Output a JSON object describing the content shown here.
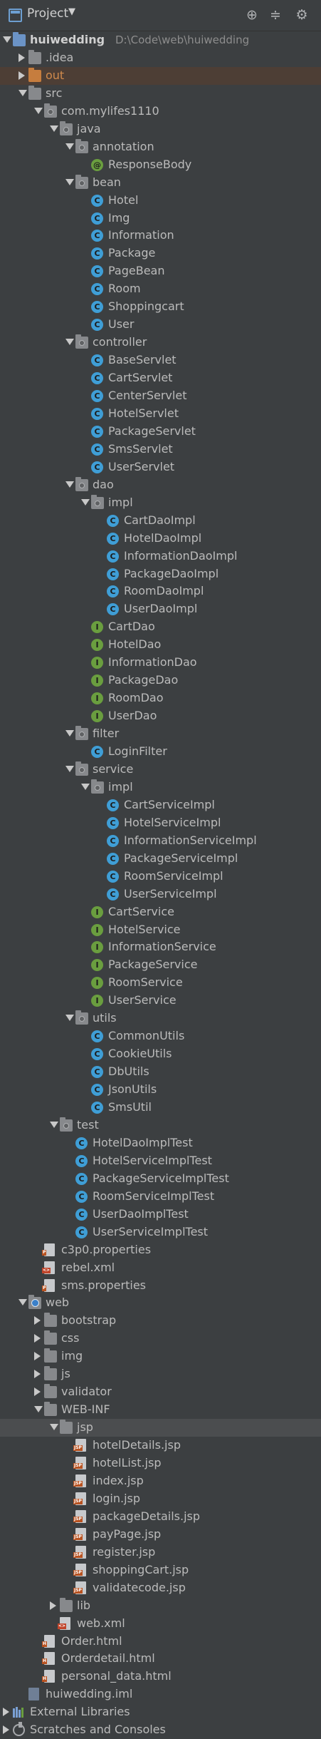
{
  "header": {
    "title": "Project",
    "icons": [
      "crosshair-icon",
      "collapse-icon",
      "gear-icon"
    ]
  },
  "root": {
    "name": "huiwedding",
    "path": "D:\\Code\\web\\huiwedding"
  },
  "tree": [
    {
      "label": "huiwedding",
      "path": "D:\\Code\\web\\huiwedding",
      "depth": 0,
      "arrow": "open",
      "icon": "module-folder",
      "bold": true
    },
    {
      "label": ".idea",
      "depth": 1,
      "arrow": "closed",
      "icon": "folder"
    },
    {
      "label": "out",
      "depth": 1,
      "arrow": "closed",
      "icon": "folder-orange",
      "excluded": true
    },
    {
      "label": "src",
      "depth": 1,
      "arrow": "open",
      "icon": "folder"
    },
    {
      "label": "com.mylifes1110",
      "depth": 2,
      "arrow": "open",
      "icon": "package"
    },
    {
      "label": "java",
      "depth": 3,
      "arrow": "open",
      "icon": "package"
    },
    {
      "label": "annotation",
      "depth": 4,
      "arrow": "open",
      "icon": "package"
    },
    {
      "label": "ResponseBody",
      "depth": 5,
      "arrow": "none",
      "icon": "annotation"
    },
    {
      "label": "bean",
      "depth": 4,
      "arrow": "open",
      "icon": "package"
    },
    {
      "label": "Hotel",
      "depth": 5,
      "arrow": "none",
      "icon": "class"
    },
    {
      "label": "Img",
      "depth": 5,
      "arrow": "none",
      "icon": "class"
    },
    {
      "label": "Information",
      "depth": 5,
      "arrow": "none",
      "icon": "class"
    },
    {
      "label": "Package",
      "depth": 5,
      "arrow": "none",
      "icon": "class"
    },
    {
      "label": "PageBean",
      "depth": 5,
      "arrow": "none",
      "icon": "class"
    },
    {
      "label": "Room",
      "depth": 5,
      "arrow": "none",
      "icon": "class"
    },
    {
      "label": "Shoppingcart",
      "depth": 5,
      "arrow": "none",
      "icon": "class"
    },
    {
      "label": "User",
      "depth": 5,
      "arrow": "none",
      "icon": "class"
    },
    {
      "label": "controller",
      "depth": 4,
      "arrow": "open",
      "icon": "package"
    },
    {
      "label": "BaseServlet",
      "depth": 5,
      "arrow": "none",
      "icon": "class"
    },
    {
      "label": "CartServlet",
      "depth": 5,
      "arrow": "none",
      "icon": "class"
    },
    {
      "label": "CenterServlet",
      "depth": 5,
      "arrow": "none",
      "icon": "class"
    },
    {
      "label": "HotelServlet",
      "depth": 5,
      "arrow": "none",
      "icon": "class"
    },
    {
      "label": "PackageServlet",
      "depth": 5,
      "arrow": "none",
      "icon": "class"
    },
    {
      "label": "SmsServlet",
      "depth": 5,
      "arrow": "none",
      "icon": "class"
    },
    {
      "label": "UserServlet",
      "depth": 5,
      "arrow": "none",
      "icon": "class"
    },
    {
      "label": "dao",
      "depth": 4,
      "arrow": "open",
      "icon": "package"
    },
    {
      "label": "impl",
      "depth": 5,
      "arrow": "open",
      "icon": "package"
    },
    {
      "label": "CartDaoImpl",
      "depth": 6,
      "arrow": "none",
      "icon": "class"
    },
    {
      "label": "HotelDaoImpl",
      "depth": 6,
      "arrow": "none",
      "icon": "class"
    },
    {
      "label": "InformationDaoImpl",
      "depth": 6,
      "arrow": "none",
      "icon": "class"
    },
    {
      "label": "PackageDaoImpl",
      "depth": 6,
      "arrow": "none",
      "icon": "class"
    },
    {
      "label": "RoomDaoImpl",
      "depth": 6,
      "arrow": "none",
      "icon": "class"
    },
    {
      "label": "UserDaoImpl",
      "depth": 6,
      "arrow": "none",
      "icon": "class"
    },
    {
      "label": "CartDao",
      "depth": 5,
      "arrow": "none",
      "icon": "interface"
    },
    {
      "label": "HotelDao",
      "depth": 5,
      "arrow": "none",
      "icon": "interface"
    },
    {
      "label": "InformationDao",
      "depth": 5,
      "arrow": "none",
      "icon": "interface"
    },
    {
      "label": "PackageDao",
      "depth": 5,
      "arrow": "none",
      "icon": "interface"
    },
    {
      "label": "RoomDao",
      "depth": 5,
      "arrow": "none",
      "icon": "interface"
    },
    {
      "label": "UserDao",
      "depth": 5,
      "arrow": "none",
      "icon": "interface"
    },
    {
      "label": "filter",
      "depth": 4,
      "arrow": "open",
      "icon": "package"
    },
    {
      "label": "LoginFilter",
      "depth": 5,
      "arrow": "none",
      "icon": "class"
    },
    {
      "label": "service",
      "depth": 4,
      "arrow": "open",
      "icon": "package"
    },
    {
      "label": "impl",
      "depth": 5,
      "arrow": "open",
      "icon": "package"
    },
    {
      "label": "CartServiceImpl",
      "depth": 6,
      "arrow": "none",
      "icon": "class"
    },
    {
      "label": "HotelServiceImpl",
      "depth": 6,
      "arrow": "none",
      "icon": "class"
    },
    {
      "label": "InformationServiceImpl",
      "depth": 6,
      "arrow": "none",
      "icon": "class"
    },
    {
      "label": "PackageServiceImpl",
      "depth": 6,
      "arrow": "none",
      "icon": "class"
    },
    {
      "label": "RoomServiceImpl",
      "depth": 6,
      "arrow": "none",
      "icon": "class"
    },
    {
      "label": "UserServiceImpl",
      "depth": 6,
      "arrow": "none",
      "icon": "class"
    },
    {
      "label": "CartService",
      "depth": 5,
      "arrow": "none",
      "icon": "interface"
    },
    {
      "label": "HotelService",
      "depth": 5,
      "arrow": "none",
      "icon": "interface"
    },
    {
      "label": "InformationService",
      "depth": 5,
      "arrow": "none",
      "icon": "interface"
    },
    {
      "label": "PackageService",
      "depth": 5,
      "arrow": "none",
      "icon": "interface"
    },
    {
      "label": "RoomService",
      "depth": 5,
      "arrow": "none",
      "icon": "interface"
    },
    {
      "label": "UserService",
      "depth": 5,
      "arrow": "none",
      "icon": "interface"
    },
    {
      "label": "utils",
      "depth": 4,
      "arrow": "open",
      "icon": "package"
    },
    {
      "label": "CommonUtils",
      "depth": 5,
      "arrow": "none",
      "icon": "class"
    },
    {
      "label": "CookieUtils",
      "depth": 5,
      "arrow": "none",
      "icon": "class"
    },
    {
      "label": "DbUtils",
      "depth": 5,
      "arrow": "none",
      "icon": "class"
    },
    {
      "label": "JsonUtils",
      "depth": 5,
      "arrow": "none",
      "icon": "class"
    },
    {
      "label": "SmsUtil",
      "depth": 5,
      "arrow": "none",
      "icon": "class"
    },
    {
      "label": "test",
      "depth": 3,
      "arrow": "open",
      "icon": "package"
    },
    {
      "label": "HotelDaoImplTest",
      "depth": 4,
      "arrow": "none",
      "icon": "class"
    },
    {
      "label": "HotelServiceImplTest",
      "depth": 4,
      "arrow": "none",
      "icon": "class"
    },
    {
      "label": "PackageServiceImplTest",
      "depth": 4,
      "arrow": "none",
      "icon": "class"
    },
    {
      "label": "RoomServiceImplTest",
      "depth": 4,
      "arrow": "none",
      "icon": "class"
    },
    {
      "label": "UserDaoImplTest",
      "depth": 4,
      "arrow": "none",
      "icon": "class"
    },
    {
      "label": "UserServiceImplTest",
      "depth": 4,
      "arrow": "none",
      "icon": "class"
    },
    {
      "label": "c3p0.properties",
      "depth": 2,
      "arrow": "none",
      "icon": "properties-file"
    },
    {
      "label": "rebel.xml",
      "depth": 2,
      "arrow": "none",
      "icon": "xml-file"
    },
    {
      "label": "sms.properties",
      "depth": 2,
      "arrow": "none",
      "icon": "properties-file"
    },
    {
      "label": "web",
      "depth": 1,
      "arrow": "open",
      "icon": "web-folder"
    },
    {
      "label": "bootstrap",
      "depth": 2,
      "arrow": "closed",
      "icon": "folder"
    },
    {
      "label": "css",
      "depth": 2,
      "arrow": "closed",
      "icon": "folder"
    },
    {
      "label": "img",
      "depth": 2,
      "arrow": "closed",
      "icon": "folder"
    },
    {
      "label": "js",
      "depth": 2,
      "arrow": "closed",
      "icon": "folder"
    },
    {
      "label": "validator",
      "depth": 2,
      "arrow": "closed",
      "icon": "folder"
    },
    {
      "label": "WEB-INF",
      "depth": 2,
      "arrow": "open",
      "icon": "folder"
    },
    {
      "label": "jsp",
      "depth": 3,
      "arrow": "open",
      "icon": "folder",
      "selected": true
    },
    {
      "label": "hotelDetails.jsp",
      "depth": 4,
      "arrow": "none",
      "icon": "jsp-file"
    },
    {
      "label": "hotelList.jsp",
      "depth": 4,
      "arrow": "none",
      "icon": "jsp-file"
    },
    {
      "label": "index.jsp",
      "depth": 4,
      "arrow": "none",
      "icon": "jsp-file"
    },
    {
      "label": "login.jsp",
      "depth": 4,
      "arrow": "none",
      "icon": "jsp-file"
    },
    {
      "label": "packageDetails.jsp",
      "depth": 4,
      "arrow": "none",
      "icon": "jsp-file"
    },
    {
      "label": "payPage.jsp",
      "depth": 4,
      "arrow": "none",
      "icon": "jsp-file"
    },
    {
      "label": "register.jsp",
      "depth": 4,
      "arrow": "none",
      "icon": "jsp-file"
    },
    {
      "label": "shoppingCart.jsp",
      "depth": 4,
      "arrow": "none",
      "icon": "jsp-file"
    },
    {
      "label": "validatecode.jsp",
      "depth": 4,
      "arrow": "none",
      "icon": "jsp-file"
    },
    {
      "label": "lib",
      "depth": 3,
      "arrow": "closed",
      "icon": "folder"
    },
    {
      "label": "web.xml",
      "depth": 3,
      "arrow": "none",
      "icon": "web-xml-file"
    },
    {
      "label": "Order.html",
      "depth": 2,
      "arrow": "none",
      "icon": "html-file"
    },
    {
      "label": "Orderdetail.html",
      "depth": 2,
      "arrow": "none",
      "icon": "html-file"
    },
    {
      "label": "personal_data.html",
      "depth": 2,
      "arrow": "none",
      "icon": "html-file"
    },
    {
      "label": "huiwedding.iml",
      "depth": 1,
      "arrow": "none",
      "icon": "iml-file"
    },
    {
      "label": "External Libraries",
      "depth": 0,
      "arrow": "closed",
      "icon": "libraries"
    },
    {
      "label": "Scratches and Consoles",
      "depth": 0,
      "arrow": "closed",
      "icon": "scratches"
    }
  ],
  "colors": {
    "background": "#3c3f41",
    "selection": "#4b4d4f",
    "excluded": "#4d3e35",
    "class_icon": "#3f9ed6",
    "interface_icon": "#6a9e3f",
    "text": "#bbbbbb"
  }
}
